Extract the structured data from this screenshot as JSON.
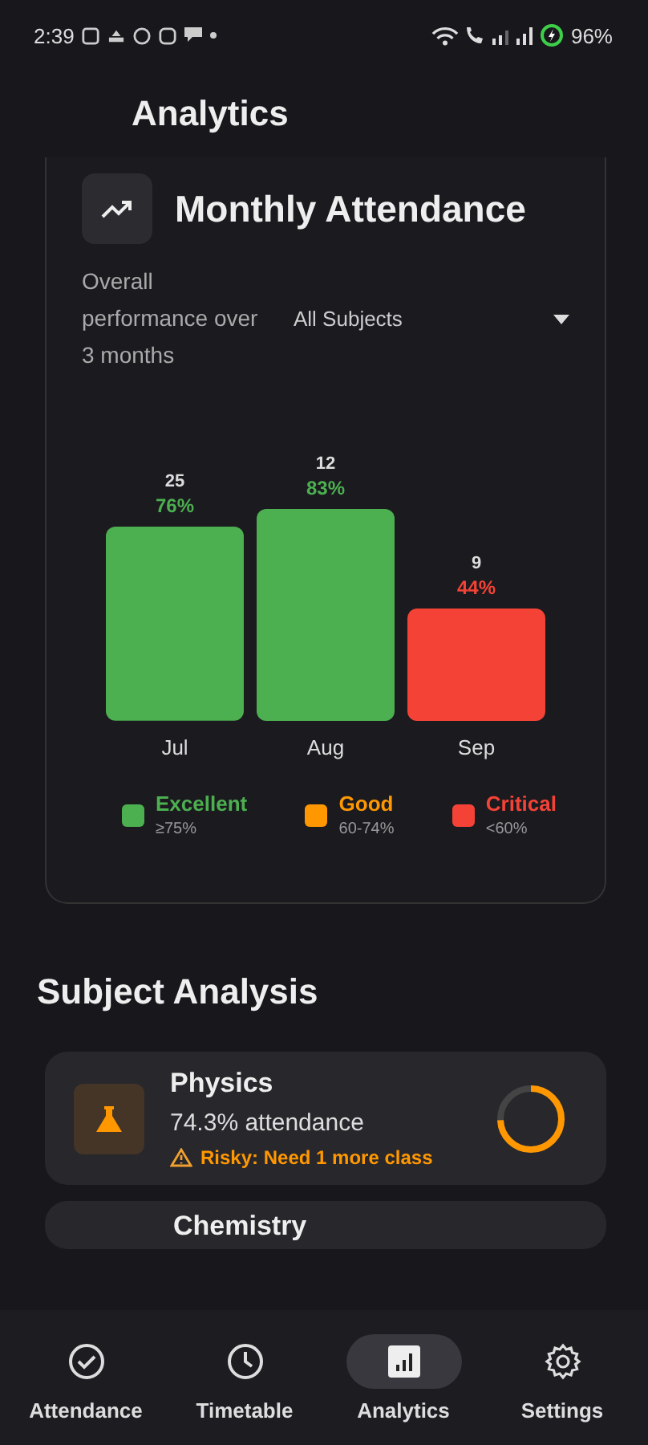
{
  "status_bar": {
    "time": "2:39",
    "battery": "96%"
  },
  "header": {
    "title": "Analytics"
  },
  "attendance_card": {
    "title": "Monthly Attendance",
    "subtitle": "Overall performance over 3 months",
    "dropdown": {
      "value": "All Subjects"
    },
    "chart_data": {
      "type": "bar",
      "categories": [
        "Jul",
        "Aug",
        "Sep"
      ],
      "values": [
        76,
        83,
        44
      ],
      "data_labels": true,
      "value_labels": [
        "76%",
        "83%",
        "44%"
      ]
    },
    "bar_details": [
      {
        "count": "25",
        "color": "#4caf50"
      },
      {
        "count": "12",
        "color": "#4caf50"
      },
      {
        "count": "9",
        "color": "#f44336"
      }
    ],
    "legend": [
      {
        "label": "Excellent",
        "range": "≥75%",
        "color": "#4caf50"
      },
      {
        "label": "Good",
        "range": "60-74%",
        "color": "#ff9800"
      },
      {
        "label": "Critical",
        "range": "<60%",
        "color": "#f44336"
      }
    ]
  },
  "subject_analysis": {
    "title": "Subject Analysis",
    "subjects": [
      {
        "name": "Physics",
        "attendance": "74.3% attendance",
        "color": "#ff9800",
        "warning": "Risky: Need 1 more class",
        "level": 0.743
      },
      {
        "name": "Chemistry"
      }
    ]
  },
  "bottom_nav": [
    {
      "label": "Attendance",
      "selected": false
    },
    {
      "label": "Timetable",
      "selected": false
    },
    {
      "label": "Analytics",
      "selected": true
    },
    {
      "label": "Settings",
      "selected": false
    }
  ]
}
